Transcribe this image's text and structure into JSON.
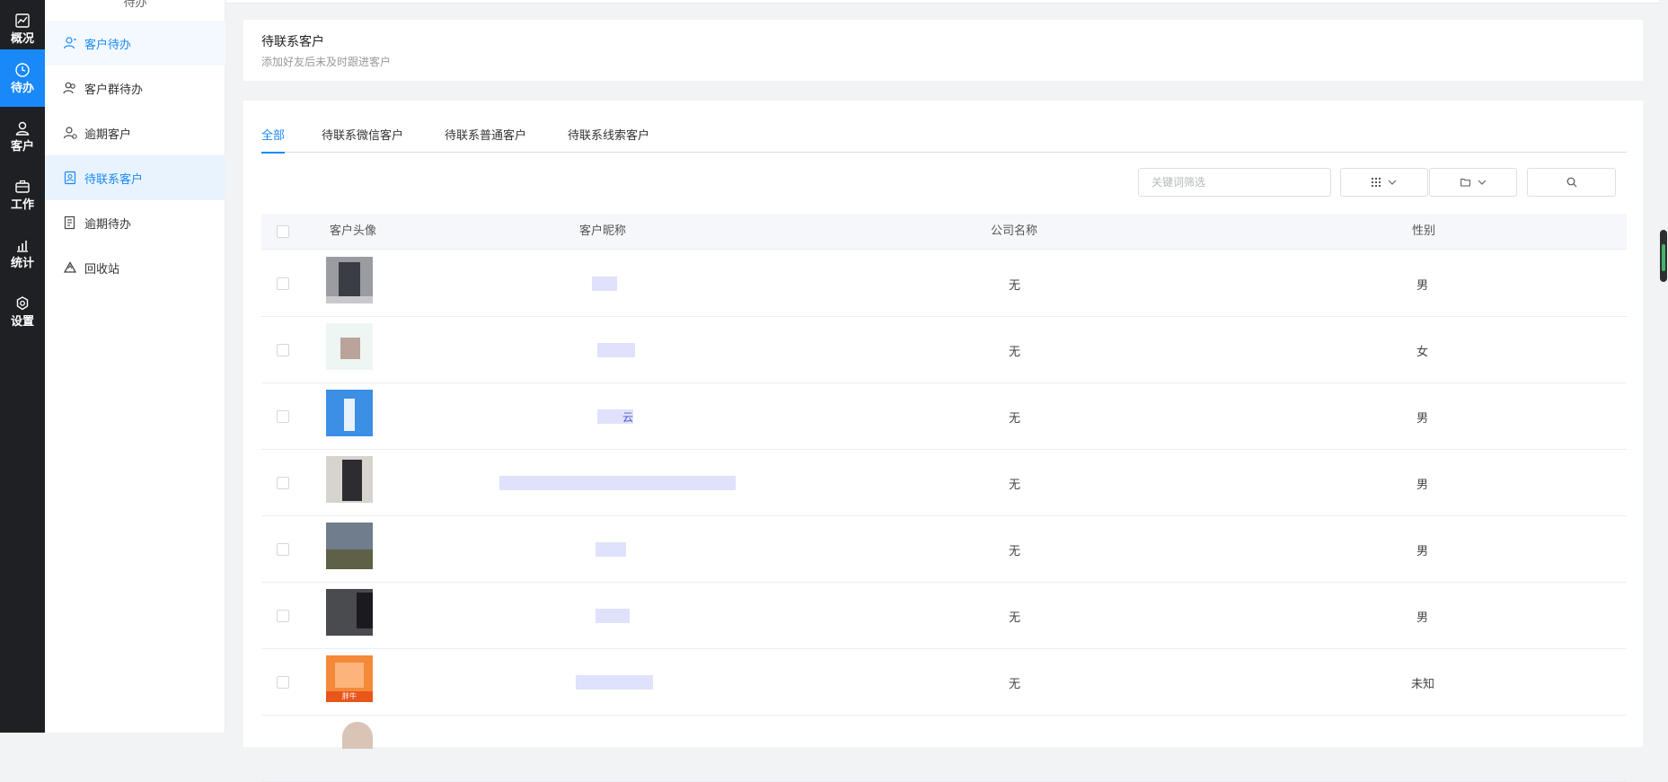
{
  "rail": {
    "items": [
      {
        "label": "概况",
        "icon": "chart-icon",
        "active": false
      },
      {
        "label": "待办",
        "icon": "clock-icon",
        "active": true
      },
      {
        "label": "客户",
        "icon": "user-icon",
        "active": false
      },
      {
        "label": "工作",
        "icon": "briefcase-icon",
        "active": false
      },
      {
        "label": "统计",
        "icon": "bar-chart-icon",
        "active": false
      },
      {
        "label": "设置",
        "icon": "gear-icon",
        "active": false
      }
    ]
  },
  "submenu": {
    "title": "待办",
    "items": [
      {
        "label": "客户待办",
        "icon": "user-todo-icon",
        "active": false
      },
      {
        "label": "客户群待办",
        "icon": "group-icon",
        "active": false
      },
      {
        "label": "逾期客户",
        "icon": "user-overdue-icon",
        "active": false
      },
      {
        "label": "待联系客户",
        "icon": "contact-card-icon",
        "active": true
      },
      {
        "label": "逾期待办",
        "icon": "document-icon",
        "active": false
      },
      {
        "label": "回收站",
        "icon": "recycle-icon",
        "active": false
      }
    ]
  },
  "header": {
    "title": "待联系客户",
    "subtitle": "添加好友后未及时跟进客户"
  },
  "tabs": [
    {
      "label": "全部",
      "active": true
    },
    {
      "label": "待联系微信客户",
      "active": false
    },
    {
      "label": "待联系普通客户",
      "active": false
    },
    {
      "label": "待联系线索客户",
      "active": false
    }
  ],
  "toolbar": {
    "keyword_placeholder": "关键词筛选",
    "grid_button_icon": "grid-icon",
    "folder_button_icon": "folder-icon",
    "search_button_icon": "search-icon"
  },
  "table": {
    "columns": [
      "客户头像",
      "客户昵称",
      "公司名称",
      "性别"
    ],
    "rows": [
      {
        "nickname": "",
        "company": "无",
        "gender": "男"
      },
      {
        "nickname": "",
        "company": "无",
        "gender": "女"
      },
      {
        "nickname": "云",
        "company": "无",
        "gender": "男"
      },
      {
        "nickname": "",
        "company": "无",
        "gender": "男"
      },
      {
        "nickname": "",
        "company": "无",
        "gender": "男"
      },
      {
        "nickname": "",
        "company": "无",
        "gender": "男"
      },
      {
        "nickname": "",
        "company": "无",
        "gender": "未知",
        "avatar_label": "胖牛"
      }
    ]
  },
  "colors": {
    "accent": "#1989fa",
    "rail_bg": "#1f2023",
    "active_menu_bg": "#e8f3fe"
  }
}
